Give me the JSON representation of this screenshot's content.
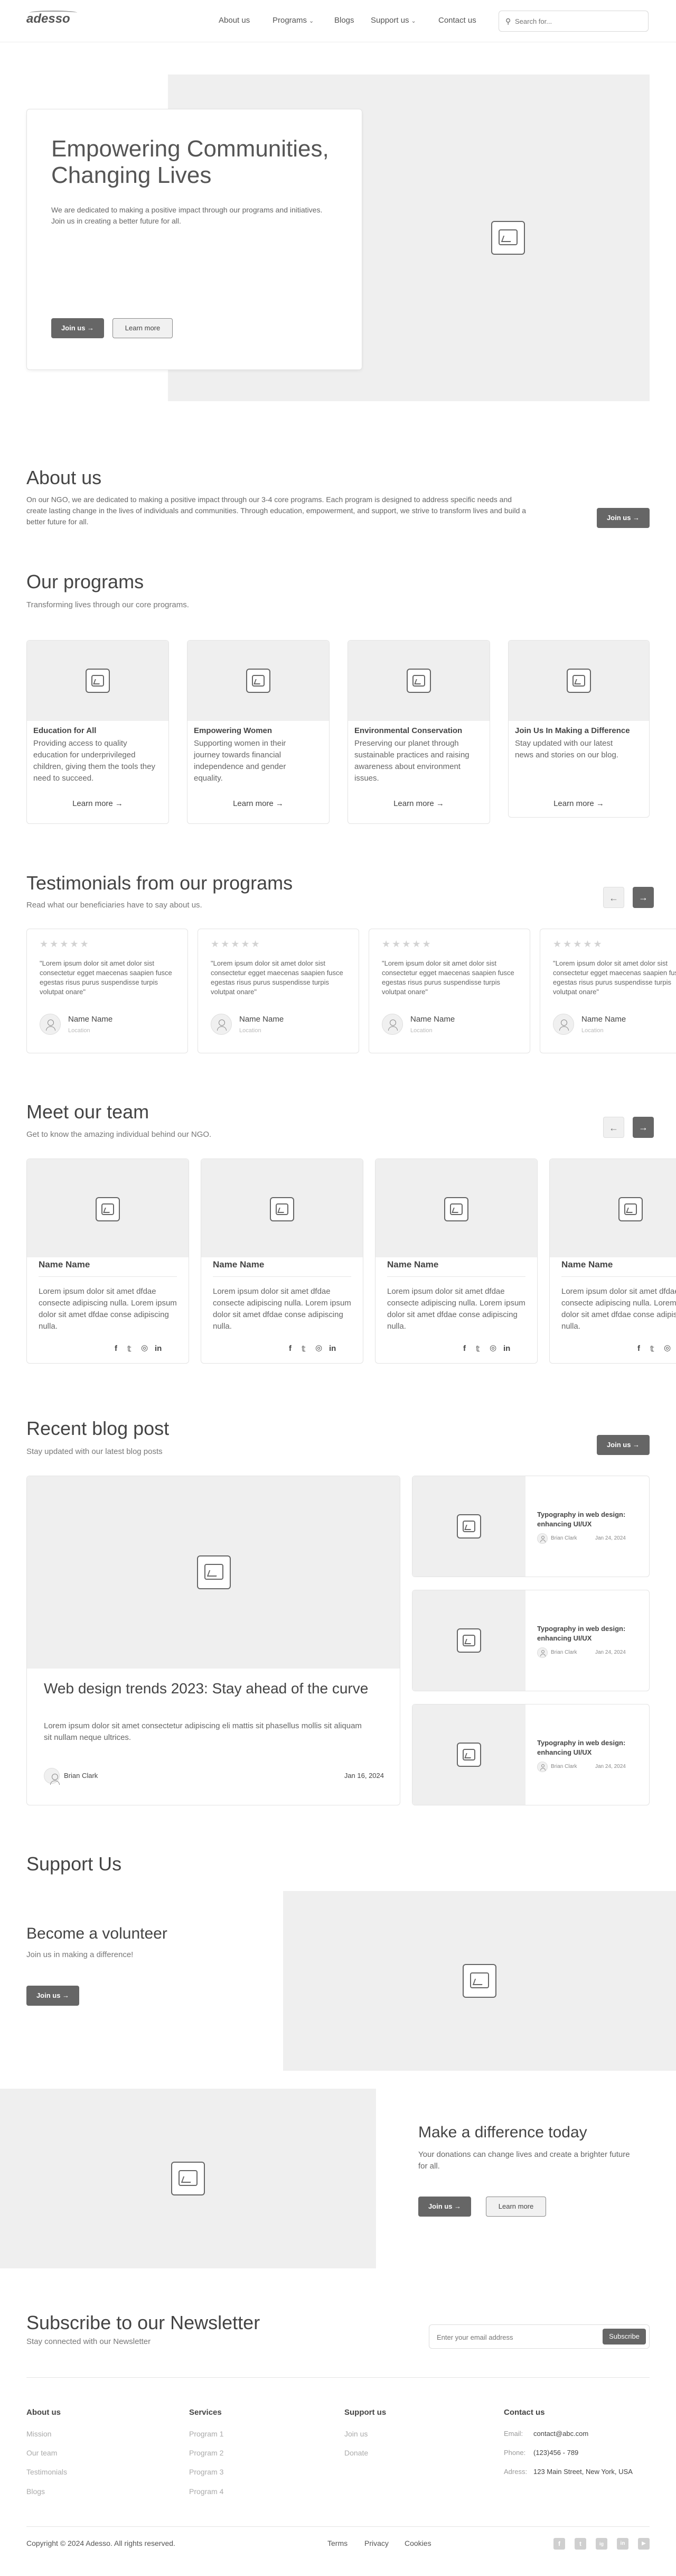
{
  "header": {
    "logo": "adesso",
    "nav": {
      "about": "About us",
      "programs": "Programs",
      "blogs": "Blogs",
      "support": "Support us",
      "contact": "Contact us"
    },
    "search_placeholder": "Search for..."
  },
  "hero": {
    "title": "Empowering Communities, Changing Lives",
    "text": "We are dedicated to making a positive impact through our programs and initiatives. Join us in creating a better future for all.",
    "join": "Join us →",
    "learn": "Learn more"
  },
  "about": {
    "title": "About us",
    "text": "On our NGO, we are dedicated to making a positive impact through our 3-4 core programs. Each program is designed to address specific needs and create lasting change in the lives of individuals and communities. Through education, empowerment, and support, we strive to transform lives and build a better future for all.",
    "join": "Join us →"
  },
  "programs": {
    "title": "Our programs",
    "subtitle": "Transforming lives through our core programs.",
    "items": [
      {
        "title": "Education for All",
        "text": "Providing access to quality education for underprivileged children, giving them the tools they need to succeed.",
        "link": "Learn more →"
      },
      {
        "title": "Empowering Women",
        "text": "Supporting women in their journey towards financial independence and gender equality.",
        "link": "Learn more →"
      },
      {
        "title": "Environmental Conservation",
        "text": "Preserving our planet through sustainable practices and raising awareness about environment issues.",
        "link": "Learn more →"
      },
      {
        "title": "Join Us In Making a Difference",
        "text": "Stay updated with our latest news and stories on our blog.",
        "link": "Learn more →"
      }
    ]
  },
  "testimonials": {
    "title": "Testimonials from our programs",
    "subtitle": "Read what our beneficiaries have to say about us.",
    "stars": "★★★★★",
    "items": [
      {
        "quote": "\"Lorem ipsum dolor sit amet dolor sist consectetur egget maecenas saapien fusce egestas risus purus suspendisse turpis volutpat onare\"",
        "name": "Name Name",
        "role": "Location"
      },
      {
        "quote": "\"Lorem ipsum dolor sit amet dolor sist consectetur egget maecenas saapien fusce egestas risus purus suspendisse turpis volutpat onare\"",
        "name": "Name Name",
        "role": "Location"
      },
      {
        "quote": "\"Lorem ipsum dolor sit amet dolor sist consectetur egget maecenas saapien fusce egestas risus purus suspendisse turpis volutpat onare\"",
        "name": "Name Name",
        "role": "Location"
      },
      {
        "quote": "\"Lorem ipsum dolor sit amet dolor sist consectetur egget maecenas saapien fusce egestas risus purus suspendisse turpis volutpat onare\"",
        "name": "Name Name",
        "role": "Location"
      }
    ]
  },
  "team": {
    "title": "Meet our team",
    "subtitle": "Get to know the amazing individual behind our NGO.",
    "members": [
      {
        "name": "Name Name",
        "bio": "Lorem ipsum dolor sit amet dfdae consecte adipiscing nulla. Lorem ipsum dolor sit amet dfdae conse adipiscing nulla."
      },
      {
        "name": "Name Name",
        "bio": "Lorem ipsum dolor sit amet dfdae consecte adipiscing nulla. Lorem ipsum dolor sit amet dfdae conse adipiscing nulla."
      },
      {
        "name": "Name Name",
        "bio": "Lorem ipsum dolor sit amet dfdae consecte adipiscing nulla. Lorem ipsum dolor sit amet dfdae conse adipiscing nulla."
      },
      {
        "name": "Name Name",
        "bio": "Lorem ipsum dolor sit amet dfdae consecte adipiscing nulla. Lorem ipsum dolor sit amet dfdae conse adipiscing nulla."
      }
    ]
  },
  "blog": {
    "title": "Recent blog post",
    "subtitle": "Stay updated with our latest blog posts",
    "join": "Join us →",
    "featured": {
      "title": "Web design trends 2023: Stay ahead of the curve",
      "excerpt": "Lorem ipsum dolor sit amet consectetur adipiscing eli mattis sit phasellus mollis sit aliquam sit nullam neque ultrices.",
      "author": "Brian Clark",
      "date": "Jan 16, 2024"
    },
    "posts": [
      {
        "title": "Typography in web design: enhancing UI/UX",
        "author": "Brian Clark",
        "date": "Jan 24, 2024"
      },
      {
        "title": "Typography in web design: enhancing UI/UX",
        "author": "Brian Clark",
        "date": "Jan 24, 2024"
      },
      {
        "title": "Typography in web design: enhancing UI/UX",
        "author": "Brian Clark",
        "date": "Jan 24, 2024"
      }
    ]
  },
  "support": {
    "title": "Support Us",
    "volunteer_title": "Become a volunteer",
    "volunteer_sub": "Join us in making a difference!",
    "volunteer_btn": "Join us →",
    "diff_title": "Make a difference today",
    "diff_text": "Your donations can change lives and create a brighter future for all.",
    "diff_join": "Join us →",
    "diff_learn": "Learn more"
  },
  "newsletter": {
    "title": "Subscribe to our Newsletter",
    "subtitle": "Stay connected with our Newsletter",
    "placeholder": "Enter your email address",
    "button": "Subscribe"
  },
  "footer": {
    "about_head": "About us",
    "about_links": [
      "Mission",
      "Our team",
      "Testimonials",
      "Blogs"
    ],
    "services_head": "Services",
    "services_links": [
      "Program 1",
      "Program 2",
      "Program 3",
      "Program 4"
    ],
    "support_head": "Support us",
    "support_links": [
      "Join us",
      "Donate"
    ],
    "contact_head": "Contact us",
    "email_label": "Email:",
    "email": "contact@abc.com",
    "phone_label": "Phone:",
    "phone": "(123)456 - 789",
    "address_label": "Adress:",
    "address": "123 Main Street, New York, USA",
    "copyright": "Copyright © 2024 Adesso. All rights reserved.",
    "terms": "Terms",
    "privacy": "Privacy",
    "cookies": "Cookies",
    "social_glyphs": [
      "f",
      "t",
      "ig",
      "in"
    ]
  }
}
